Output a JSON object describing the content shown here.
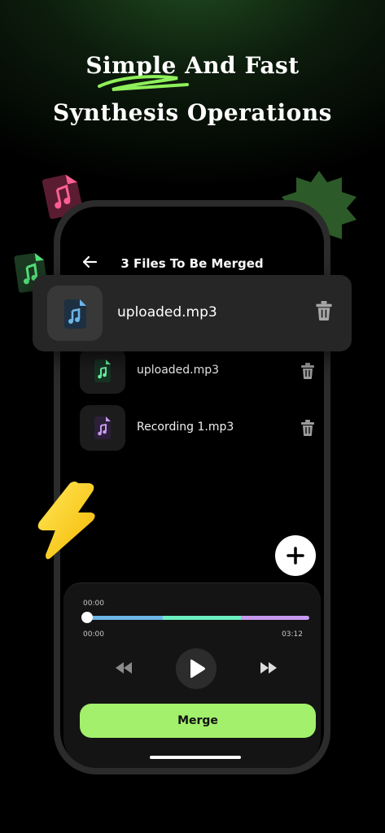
{
  "promo": {
    "headline_line1": "Simple And Fast",
    "headline_line2": "Synthesis Operations"
  },
  "screen": {
    "title": "3 Files To Be Merged",
    "highlighted_file": {
      "name": "uploaded.mp3",
      "icon": "music-file-icon",
      "color": "#6cb6e8"
    },
    "files": [
      {
        "name": "uploaded.mp3",
        "icon": "music-file-icon",
        "color": "#6cf0a0"
      },
      {
        "name": "Recording 1.mp3",
        "icon": "music-file-icon",
        "color": "#c79af0"
      }
    ],
    "add_icon": "plus-icon"
  },
  "player": {
    "current_time_top": "00:00",
    "start_time": "00:00",
    "end_time": "03:12",
    "progress": 0.0,
    "segment_colors": [
      "#6cb6e8",
      "#6cf0c2",
      "#c79af0"
    ],
    "merge_label": "Merge"
  },
  "colors": {
    "accent": "#a2f06c",
    "background": "#000000"
  }
}
